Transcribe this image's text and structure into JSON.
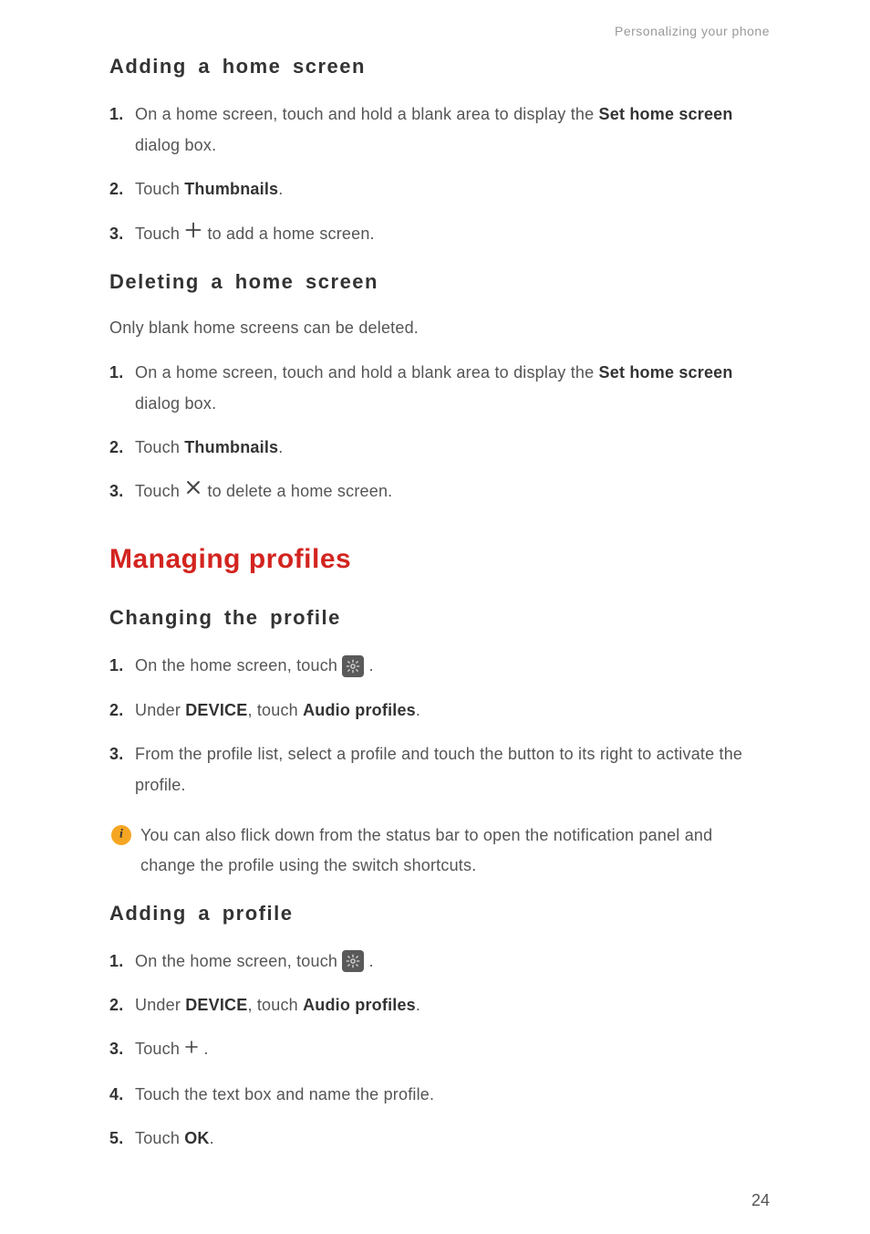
{
  "header": {
    "running_head": "Personalizing your phone"
  },
  "s1": {
    "title": "Adding a home screen",
    "step1_a": "On a home screen, touch and hold a blank area to display the ",
    "step1_b": "Set home screen",
    "step1_c": " dialog box.",
    "step2_a": "Touch ",
    "step2_b": "Thumbnails",
    "step2_c": ".",
    "step3_a": "Touch ",
    "step3_b": " to add a home screen."
  },
  "s2": {
    "title": "Deleting a home screen",
    "intro": "Only blank home screens can be deleted.",
    "step1_a": "On a home screen, touch and hold a blank area to display the ",
    "step1_b": "Set home screen",
    "step1_c": " dialog box.",
    "step2_a": "Touch ",
    "step2_b": "Thumbnails",
    "step2_c": ".",
    "step3_a": "Touch ",
    "step3_b": " to delete a home screen."
  },
  "chapter": {
    "title": "Managing profiles"
  },
  "s3": {
    "title": "Changing the profile",
    "step1_a": "On the home screen, touch ",
    "step1_b": " .",
    "step2_a": "Under ",
    "step2_b": "DEVICE",
    "step2_c": ", touch ",
    "step2_d": "Audio profiles",
    "step2_e": ".",
    "step3": "From the profile list, select a profile and touch the button to its right to activate the profile.",
    "note": "You can also flick down from the status bar to open the notification panel and change the profile using the switch shortcuts."
  },
  "s4": {
    "title": "Adding a profile",
    "step1_a": "On the home screen, touch ",
    "step1_b": " .",
    "step2_a": "Under ",
    "step2_b": "DEVICE",
    "step2_c": ", touch ",
    "step2_d": "Audio profiles",
    "step2_e": ".",
    "step3_a": "Touch ",
    "step3_b": " .",
    "step4": "Touch the text box and name the profile.",
    "step5_a": "Touch ",
    "step5_b": "OK",
    "step5_c": "."
  },
  "page_number": "24"
}
